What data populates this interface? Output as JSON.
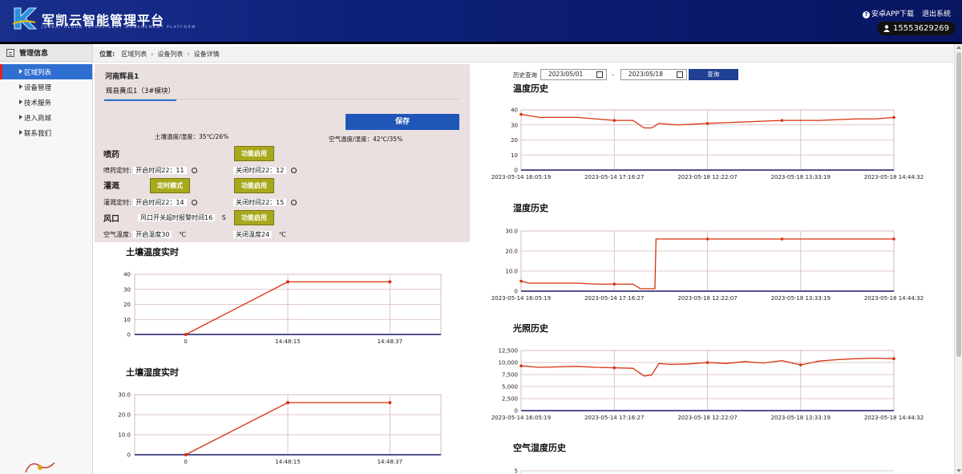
{
  "header": {
    "title": "军凯云智能管理平台",
    "subtitle": "JUNKAI CLOUD INTELLIGENT MANAGEMENT PLATFORM",
    "app_download": "安卓APP下载",
    "logout": "退出系统",
    "user_phone": "15553629269"
  },
  "sidebar": {
    "heading": "管理信息",
    "items": [
      {
        "label": "区域列表"
      },
      {
        "label": "设备管理"
      },
      {
        "label": "技术服务"
      },
      {
        "label": "进入商城"
      },
      {
        "label": "联系我们"
      }
    ]
  },
  "breadcrumb": {
    "prefix": "位置:",
    "items": [
      "区域列表",
      "设备列表",
      "设备详情"
    ]
  },
  "device": {
    "region": "河南辉县1",
    "tab": "辉县黄瓜1（3#模块）",
    "save_label": "保存",
    "soil_reading": "土壤温度/湿度：35℃/26%",
    "air_reading": "空气温度/湿度：42℃/35%",
    "spray_label": "喷药",
    "spray_btn": "功能启用",
    "spray_timer_label": "喷药定时:",
    "spray_open": "开启时间22：11",
    "spray_close": "关闭时间22：12",
    "irrigate_label": "灌溉",
    "irrigate_mode_btn": "定时模式",
    "irrigate_btn": "功能启用",
    "irrigate_timer_label": "灌溉定时:",
    "irrigate_open": "开启时间22：14",
    "irrigate_close": "关闭时间22：15",
    "vent_label": "风口",
    "vent_alarm": "风口开关超时报警时间16",
    "vent_unit": "S",
    "vent_btn": "功能启用",
    "air_temp_label": "空气温度:",
    "air_open": "开启温度30",
    "air_open_unit": "℃",
    "air_close": "关闭温度24",
    "air_close_unit": "℃"
  },
  "history": {
    "query_label": "历史查询",
    "date_from": "2023/05/01",
    "date_to": "2023/05/18",
    "dash": "-",
    "query_btn": "查询"
  },
  "colors": {
    "header_bg": "#0d1f78",
    "accent_blue": "#1f56b8",
    "function_btn": "#a8a81c",
    "panel_bg": "#eae0e0",
    "series_line": "#d9300e"
  },
  "chart_data": [
    {
      "type": "line",
      "title": "土壤温度实时",
      "categories": [
        "0",
        "14:48:15",
        "14:48:37"
      ],
      "values": [
        0,
        35,
        35
      ],
      "yticks": [
        0,
        10,
        20,
        30,
        40
      ],
      "ylim": [
        0,
        40
      ]
    },
    {
      "type": "line",
      "title": "土壤湿度实时",
      "categories": [
        "0",
        "14:48:15",
        "14:48:37"
      ],
      "values": [
        0,
        26,
        26
      ],
      "yticks": [
        "0",
        "10.0",
        "20.0",
        "30.0"
      ],
      "ylim": [
        0,
        30
      ]
    },
    {
      "type": "line",
      "title": "温度历史",
      "xticks": [
        "2023-05-14 16:05:19",
        "2023-05-14 17:16:27",
        "2023-05-18 12:22:07",
        "2023-05-18 13:33:19",
        "2023-05-18 14:44:32"
      ],
      "yticks": [
        0,
        10,
        20,
        30,
        40
      ],
      "ylim": [
        0,
        40
      ],
      "x": [
        0,
        0.05,
        0.1,
        0.15,
        0.2,
        0.25,
        0.3,
        0.33,
        0.35,
        0.37,
        0.42,
        0.5,
        0.6,
        0.7,
        0.8,
        0.9,
        0.95,
        1.0
      ],
      "values": [
        37,
        35,
        35,
        35,
        34,
        33,
        33,
        28,
        28,
        31,
        30,
        31,
        32,
        33,
        33,
        34,
        34,
        35
      ]
    },
    {
      "type": "line",
      "title": "湿度历史",
      "xticks": [
        "2023-05-14 16:05:19",
        "2023-05-14 17:16:27",
        "2023-05-18 12:22:07",
        "2023-05-18 13:33:19",
        "2023-05-18 14:44:32"
      ],
      "yticks": [
        "0",
        "10.0",
        "20.0",
        "30.0"
      ],
      "ylim": [
        0,
        30
      ],
      "x": [
        0,
        0.02,
        0.15,
        0.2,
        0.25,
        0.3,
        0.32,
        0.35,
        0.359,
        0.362,
        0.4,
        0.5,
        0.7,
        0.9,
        1.0
      ],
      "values": [
        5,
        4,
        4,
        3.5,
        3.5,
        3.5,
        1.2,
        1.2,
        1.2,
        26,
        26,
        26,
        26,
        26,
        26
      ]
    },
    {
      "type": "line",
      "title": "光照历史",
      "xticks": [
        "2023-05-14 16:05:19",
        "2023-05-14 17:16:27",
        "2023-05-18 12:22:07",
        "2023-05-18 13:33:19",
        "2023-05-18 14:44:32"
      ],
      "yticks": [
        "0",
        "2,500",
        "5,000",
        "7,500",
        "10,000",
        "12,500"
      ],
      "ylim": [
        0,
        12500
      ],
      "x": [
        0,
        0.05,
        0.1,
        0.15,
        0.2,
        0.25,
        0.3,
        0.33,
        0.35,
        0.37,
        0.4,
        0.45,
        0.5,
        0.55,
        0.6,
        0.65,
        0.7,
        0.75,
        0.8,
        0.85,
        0.9,
        0.95,
        1.0
      ],
      "values": [
        9300,
        9000,
        9100,
        9200,
        9000,
        8900,
        8800,
        7200,
        7400,
        9800,
        9600,
        9700,
        10000,
        9800,
        10200,
        9900,
        10400,
        9500,
        10300,
        10600,
        10800,
        10900,
        10800
      ]
    },
    {
      "type": "line",
      "title": "空气湿度历史",
      "yticks": [
        5
      ],
      "values": []
    }
  ]
}
